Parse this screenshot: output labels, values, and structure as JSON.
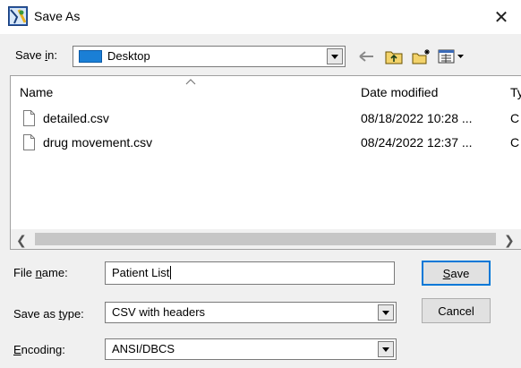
{
  "window": {
    "title": "Save As",
    "close_glyph": "✕"
  },
  "savein": {
    "label_pre": "Save ",
    "label_accel": "i",
    "label_post": "n:",
    "value": "Desktop"
  },
  "toolbar": {
    "icons": [
      "back-arrow-icon",
      "up-folder-icon",
      "new-folder-icon",
      "view-menu-icon"
    ]
  },
  "filelist": {
    "columns": {
      "name": "Name",
      "date": "Date modified",
      "type": "Ty"
    },
    "files": [
      {
        "name": "detailed.csv",
        "date": "08/18/2022 10:28 ...",
        "type": "C"
      },
      {
        "name": "drug movement.csv",
        "date": "08/24/2022 12:37 ...",
        "type": "C"
      }
    ]
  },
  "filename": {
    "label_pre": "File ",
    "label_accel": "n",
    "label_post": "ame:",
    "value": "Patient List"
  },
  "savetype": {
    "label_pre": "Save as ",
    "label_accel": "t",
    "label_post": "ype:",
    "value": "CSV with headers"
  },
  "encoding": {
    "label_pre": "",
    "label_accel": "E",
    "label_post": "ncoding:",
    "value": "ANSI/DBCS"
  },
  "buttons": {
    "save_accel": "S",
    "save_rest": "ave",
    "cancel": "Cancel"
  },
  "colors": {
    "accent": "#0078d7",
    "folder": "#1a7fd6"
  }
}
